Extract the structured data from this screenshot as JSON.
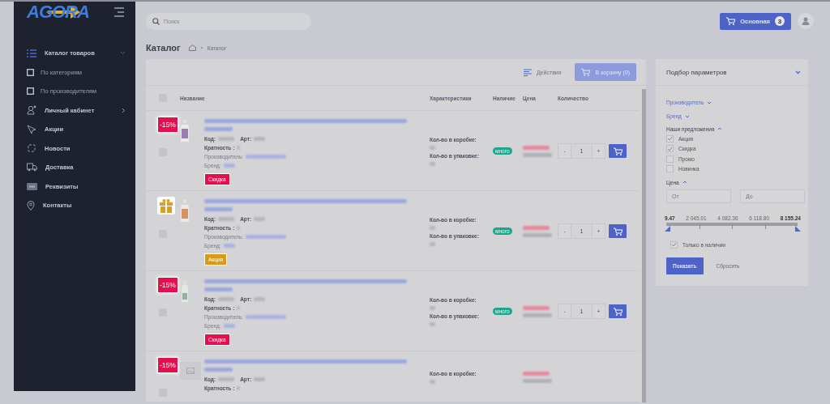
{
  "sidebar": {
    "logo": "AGORA",
    "items": [
      {
        "kind": "section",
        "label": "Каталог товаров",
        "expanded": true
      },
      {
        "kind": "sub",
        "label": "По категориям"
      },
      {
        "kind": "sub",
        "label": "По производителям"
      },
      {
        "kind": "section",
        "label": "Личный кабинет",
        "expanded": false
      },
      {
        "kind": "section",
        "label": "Акции"
      },
      {
        "kind": "section",
        "label": "Новости"
      },
      {
        "kind": "section",
        "label": "Доставка"
      },
      {
        "kind": "section",
        "label": "Реквизиты"
      },
      {
        "kind": "section",
        "label": "Контакты"
      }
    ]
  },
  "search": {
    "placeholder": "Поиск"
  },
  "cart_button": {
    "label": "Основная",
    "count": "3"
  },
  "page_title": "Каталог",
  "breadcrumb": [
    "Каталог"
  ],
  "toolbar": {
    "actions": "Действия",
    "add_to_cart": "В корзину (0)"
  },
  "table": {
    "select_all": {
      "checked": false
    },
    "columns": [
      "Название",
      "Характеристики",
      "Наличие",
      "Цена",
      "Количество"
    ],
    "rows": [
      {
        "checked": false,
        "badge": {
          "kind": "discount",
          "text": "-15%"
        },
        "code_label": "Код:",
        "art_label": "Арт:",
        "labels": [
          "Кратность :",
          "Производитель:",
          "Бренд:"
        ],
        "tag": {
          "kind": "sale",
          "text": "Скидка"
        },
        "chars": [
          "Кол-во в коробке:",
          "Кол-во в упаковке:"
        ],
        "stock": "много",
        "qty": "1",
        "minus": "-",
        "plus": "+"
      },
      {
        "checked": false,
        "badge": {
          "kind": "gift"
        },
        "code_label": "Код:",
        "art_label": "Арт:",
        "labels": [
          "Кратность :",
          "Производитель:",
          "Бренд:"
        ],
        "tag": {
          "kind": "promo",
          "text": "Акция"
        },
        "chars": [
          "Кол-во в коробке:",
          "Кол-во в упаковке:"
        ],
        "stock": "много",
        "qty": "1",
        "minus": "-",
        "plus": "+"
      },
      {
        "checked": false,
        "badge": {
          "kind": "discount",
          "text": "-15%"
        },
        "code_label": "Код:",
        "art_label": "Арт:",
        "labels": [
          "Кратность :",
          "Производитель:",
          "Бренд:"
        ],
        "tag": {
          "kind": "sale",
          "text": "Скидка"
        },
        "chars": [
          "Кол-во в коробке:",
          "Кол-во в упаковке:"
        ],
        "stock": "много",
        "qty": "1",
        "minus": "-",
        "plus": "+"
      },
      {
        "checked": false,
        "badge": {
          "kind": "discount",
          "text": "-15%"
        },
        "code_label": "Код:",
        "art_label": "Арт:",
        "labels": [
          "Кратность :"
        ],
        "chars": [
          "Кол-во в коробке:"
        ]
      }
    ]
  },
  "filter": {
    "title": "Подбор параметров",
    "groups": [
      {
        "kind": "link",
        "label": "Производитель",
        "expanded": false
      },
      {
        "kind": "link",
        "label": "Бренд",
        "expanded": false
      },
      {
        "kind": "checks",
        "label": "Наши предложения",
        "expanded": true,
        "options": [
          {
            "label": "Акция",
            "checked": true
          },
          {
            "label": "Скидка",
            "checked": true
          },
          {
            "label": "Промо",
            "checked": false
          },
          {
            "label": "Новинка",
            "checked": false
          }
        ]
      },
      {
        "kind": "range",
        "label": "Цена",
        "expanded": true,
        "fields": [
          {
            "placeholder": "От"
          },
          {
            "placeholder": "До"
          }
        ],
        "level": 1,
        "ticks": [
          "9.47",
          "2 045.91",
          "4 082.36",
          "6 118.80",
          "8 155.24"
        ]
      }
    ],
    "only_in_stock": {
      "label": "Только в наличии",
      "checked": true
    },
    "apply": "Показать",
    "reset": "Сбросить"
  }
}
